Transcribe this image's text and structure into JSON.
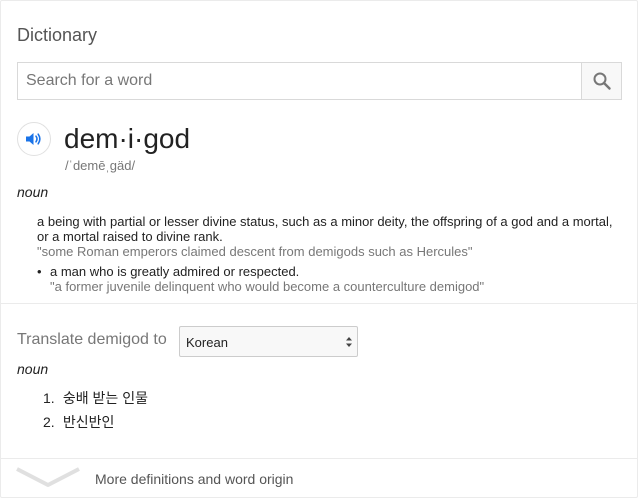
{
  "title": "Dictionary",
  "search": {
    "placeholder": "Search for a word",
    "value": "",
    "button_icon": "search-icon"
  },
  "entry": {
    "audio_icon": "speaker-icon",
    "headword": "dem·i·god",
    "phonetic": "/ˈdemēˌgäd/",
    "part_of_speech": "noun",
    "definitions": [
      {
        "text": "a being with partial or lesser divine status, such as a minor deity, the offspring of a god and a mortal, or a mortal raised to divine rank.",
        "example": "\"some Roman emperors claimed descent from demigods such as Hercules\""
      },
      {
        "bullet": "•",
        "text": "a man who is greatly admired or respected.",
        "example": "\"a former juvenile delinquent who would become a counterculture demigod\""
      }
    ]
  },
  "translate": {
    "label": "Translate demigod to",
    "language": "Korean",
    "part_of_speech": "noun",
    "results": [
      {
        "num": "1.",
        "text": "숭배 받는 인물"
      },
      {
        "num": "2.",
        "text": "반신반인"
      }
    ]
  },
  "more": {
    "icon": "chevron-down-icon",
    "label": "More definitions and word origin"
  },
  "colors": {
    "accent": "#1a73e8",
    "muted": "#777777",
    "border": "#d9d9d9"
  }
}
